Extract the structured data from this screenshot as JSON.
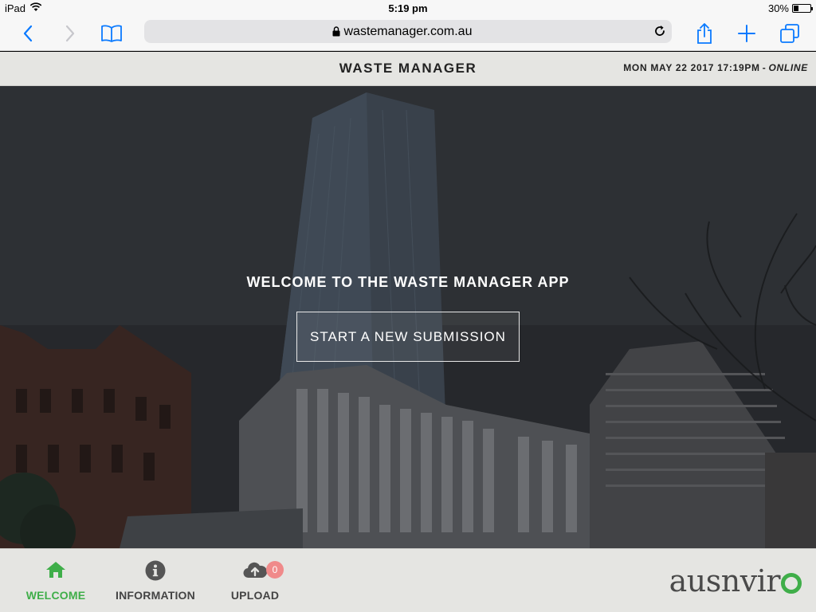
{
  "status_bar": {
    "device": "iPad",
    "time": "5:19 pm",
    "battery": "30%",
    "battery_level": 0.3
  },
  "browser": {
    "url": "wastemanager.com.au",
    "icons": [
      "back-icon",
      "forward-icon",
      "bookmarks-icon",
      "lock-icon",
      "reload-icon",
      "share-icon",
      "new-tab-icon",
      "tabs-icon"
    ]
  },
  "header": {
    "title": "WASTE MANAGER",
    "datetime": "MON MAY 22 2017 17:19PM",
    "separator": "-",
    "connection": "ONLINE"
  },
  "hero": {
    "welcome_text": "WELCOME TO THE WASTE MANAGER APP",
    "start_button": "START A NEW SUBMISSION"
  },
  "bottom_nav": {
    "items": [
      {
        "label": "WELCOME",
        "icon": "home-icon",
        "active": true
      },
      {
        "label": "INFORMATION",
        "icon": "info-icon",
        "active": false
      },
      {
        "label": "UPLOAD",
        "icon": "cloud-upload-icon",
        "active": false,
        "badge": "0"
      }
    ],
    "logo_text": "ausnvir",
    "logo_ring_letter": "o"
  },
  "colors": {
    "accent_green": "#3fae49",
    "badge": "#f08a8a",
    "header_bg": "#e5e5e2"
  }
}
